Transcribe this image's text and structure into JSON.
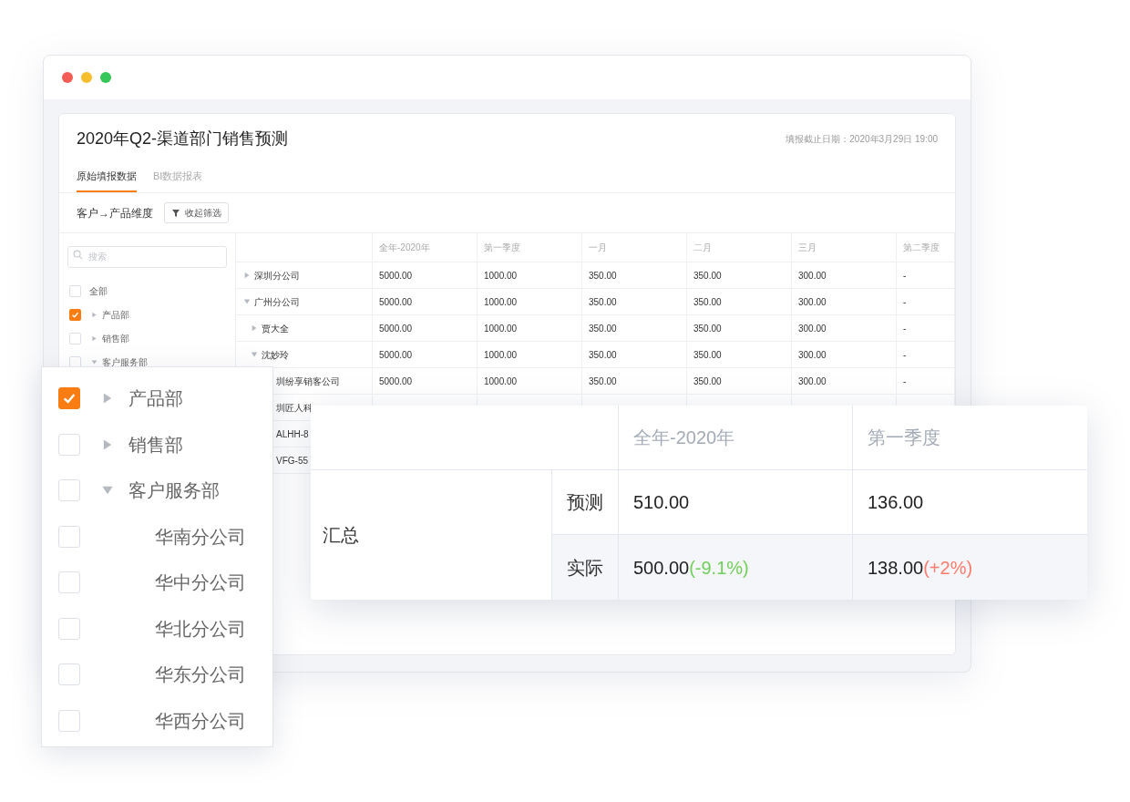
{
  "report": {
    "title": "2020年Q2-渠道部门销售预测",
    "deadline": "填报截止日期：2020年3月29日 19:00",
    "tabs": [
      {
        "label": "原始填报数据",
        "selected": true
      },
      {
        "label": "BI数据报表",
        "selected": false
      }
    ],
    "dimension_label": "客户→产品维度",
    "filter_button": "收起筛选",
    "filter": {
      "search_placeholder": "搜索",
      "items": [
        {
          "kind": "all",
          "label": "全部",
          "checked": false
        },
        {
          "kind": "group",
          "label": "产品部",
          "checked": true,
          "expanded": false
        },
        {
          "kind": "group",
          "label": "销售部",
          "checked": false,
          "expanded": false
        },
        {
          "kind": "group",
          "label": "客户服务部",
          "checked": false,
          "expanded": true
        }
      ]
    },
    "table": {
      "columns": [
        "全年-2020年",
        "第一季度",
        "一月",
        "二月",
        "三月",
        "第二季度"
      ],
      "rows": [
        {
          "kind": "group",
          "name": "深圳分公司",
          "expanded": false,
          "cells": [
            "5000.00",
            "1000.00",
            "350.00",
            "350.00",
            "300.00",
            "-"
          ]
        },
        {
          "kind": "group",
          "name": "广州分公司",
          "expanded": true,
          "cells": [
            "5000.00",
            "1000.00",
            "350.00",
            "350.00",
            "300.00",
            "-"
          ],
          "children": [
            {
              "kind": "group",
              "name": "贾大全",
              "expanded": false,
              "cells": [
                "5000.00",
                "1000.00",
                "350.00",
                "350.00",
                "300.00",
                "-"
              ]
            },
            {
              "kind": "group",
              "name": "沈妙玲",
              "expanded": true,
              "cells": [
                "5000.00",
                "1000.00",
                "350.00",
                "350.00",
                "300.00",
                "-"
              ],
              "children": [
                {
                  "kind": "leaf",
                  "name": "圳纷享销客公司",
                  "cells": [
                    "5000.00",
                    "1000.00",
                    "350.00",
                    "350.00",
                    "300.00",
                    "-"
                  ]
                },
                {
                  "kind": "leaf",
                  "name": "圳匠人科"
                },
                {
                  "kind": "leaf",
                  "name": "ALHH-8"
                },
                {
                  "kind": "leaf",
                  "name": "VFG-55"
                }
              ]
            }
          ]
        }
      ]
    }
  },
  "summary_card": {
    "columns": [
      "全年-2020年",
      "第一季度"
    ],
    "group_label": "汇总",
    "rows": [
      {
        "label": "预测",
        "cells": [
          {
            "value": "510.00"
          },
          {
            "value": "136.00"
          }
        ]
      },
      {
        "label": "实际",
        "cells": [
          {
            "value": "500.00",
            "delta": "(-9.1%)",
            "color": "#6fcf5a"
          },
          {
            "value": "138.00",
            "delta": "(+2%)",
            "color": "#ff7b6b"
          }
        ]
      }
    ]
  },
  "filter_popup": {
    "items": [
      {
        "kind": "group",
        "label": "产品部",
        "checked": true,
        "expanded": false
      },
      {
        "kind": "group",
        "label": "销售部",
        "checked": false,
        "expanded": false
      },
      {
        "kind": "group",
        "label": "客户服务部",
        "checked": false,
        "expanded": true,
        "children": [
          {
            "kind": "leaf",
            "label": "华南分公司",
            "checked": false
          },
          {
            "kind": "leaf",
            "label": "华中分公司",
            "checked": false
          },
          {
            "kind": "leaf",
            "label": "华北分公司",
            "checked": false
          },
          {
            "kind": "leaf",
            "label": "华东分公司",
            "checked": false
          },
          {
            "kind": "leaf",
            "label": "华西分公司",
            "checked": false
          }
        ]
      }
    ]
  }
}
